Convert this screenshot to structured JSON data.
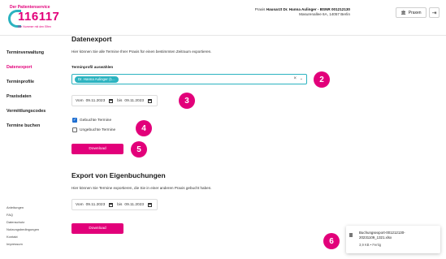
{
  "logo": {
    "tagline": "Der Patientenservice",
    "number": "116117",
    "subline": "Die Nummer mit den Elfen"
  },
  "header": {
    "practice_prefix": "Praxis",
    "practice_name": "Hausarzt Dr. Hanna Aulinger - BSNR 001212130",
    "practice_address": "Masurenallee 6A, 14057 Berlin",
    "praxen_label": "Praxen"
  },
  "sidebar": {
    "items": [
      {
        "label": "Terminverwaltung",
        "active": false
      },
      {
        "label": "Datenexport",
        "active": true
      },
      {
        "label": "Terminprofile",
        "active": false
      },
      {
        "label": "Praxisdaten",
        "active": false
      },
      {
        "label": "Vermittlungscodes",
        "active": false
      },
      {
        "label": "Termine buchen",
        "active": false
      }
    ],
    "footer": [
      "Anleitungen",
      "FAQ",
      "Datenschutz",
      "Nutzungsbedingungen",
      "Kontakt",
      "Impressum"
    ]
  },
  "export": {
    "title": "Datenexport",
    "description": "Hier können Sie alle Termine Ihrer Praxis für einen bestimmten Zeitraum exportieren.",
    "profile_label": "Terminprofil auswählen",
    "selected_profile": "Dr. Hanna Aulinger (1...",
    "from_label": "Vom",
    "from_date": "09.11.2023",
    "to_label": "bis",
    "to_date": "09.11.2023",
    "checkbox_booked": "Gebuchte Termine",
    "checkbox_unbooked": "Ungebuchte Termine",
    "download_label": "Download"
  },
  "own_export": {
    "title": "Export von Eigenbuchungen",
    "description": "Hier können Sie Termine exportieren, die Sie in einer anderen Praxis gebucht haben.",
    "from_label": "Vom",
    "from_date": "09.11.2023",
    "to_label": "bis",
    "to_date": "09.11.2023",
    "download_label": "Download"
  },
  "badges": [
    "2",
    "3",
    "4",
    "5",
    "6"
  ],
  "download_toast": {
    "filename": "Buchungsexport-001212130-20231109_1321.xlsx",
    "info": "3,9 KB • Fertig"
  },
  "colors": {
    "accent": "#e2007a",
    "teal": "#2bb3c0",
    "checkbox": "#1f6fd1"
  }
}
